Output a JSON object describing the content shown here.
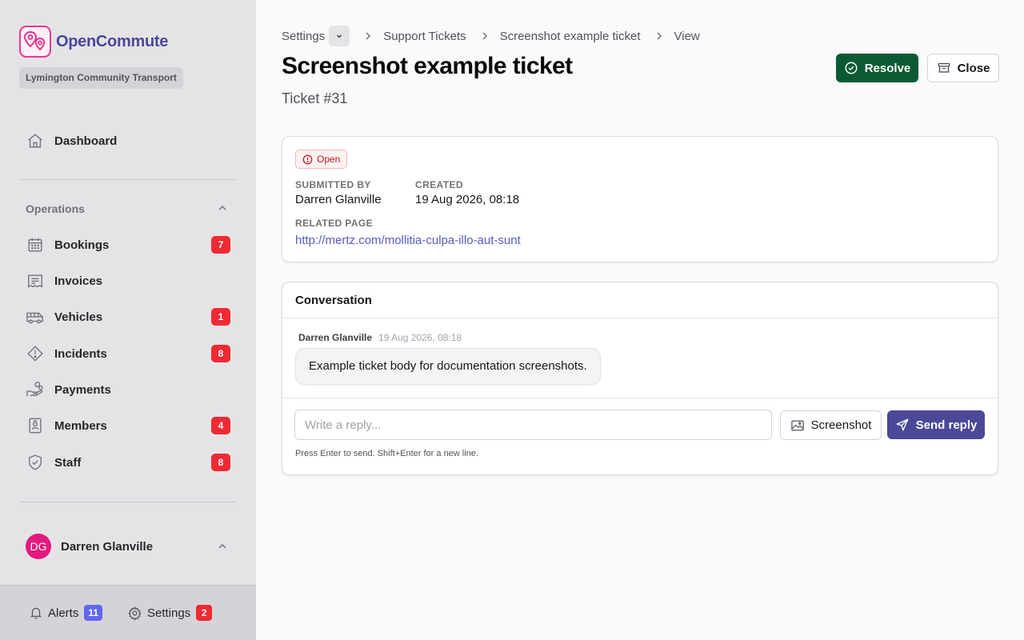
{
  "brand": {
    "name": "OpenCommute",
    "org": "Lymington Community Transport"
  },
  "sidebar": {
    "dashboard": {
      "label": "Dashboard",
      "icon": "home-icon"
    },
    "group": {
      "label": "Operations"
    },
    "items": [
      {
        "label": "Bookings",
        "icon": "calendar-icon",
        "badge": "7"
      },
      {
        "label": "Invoices",
        "icon": "receipt-icon",
        "badge": ""
      },
      {
        "label": "Vehicles",
        "icon": "bus-icon",
        "badge": "1"
      },
      {
        "label": "Incidents",
        "icon": "warning-diamond-icon",
        "badge": "8"
      },
      {
        "label": "Payments",
        "icon": "hand-coins-icon",
        "badge": ""
      },
      {
        "label": "Members",
        "icon": "id-card-icon",
        "badge": "4"
      },
      {
        "label": "Staff",
        "icon": "shield-check-icon",
        "badge": "8"
      }
    ],
    "user": {
      "initials": "DG",
      "name": "Darren Glanville"
    },
    "footer": {
      "alerts": {
        "label": "Alerts",
        "badge": "11"
      },
      "settings": {
        "label": "Settings",
        "badge": "2"
      }
    }
  },
  "breadcrumb": [
    "Settings",
    "Support Tickets",
    "Screenshot example ticket",
    "View"
  ],
  "header": {
    "title": "Screenshot example ticket",
    "subtitle": "Ticket #31",
    "resolve_label": "Resolve",
    "close_label": "Close"
  },
  "ticket": {
    "status": "Open",
    "submitted_by_label": "SUBMITTED BY",
    "submitted_by": "Darren Glanville",
    "created_label": "CREATED",
    "created": "19 Aug 2026, 08:18",
    "related_page_label": "RELATED PAGE",
    "related_page": "http://mertz.com/mollitia-culpa-illo-aut-sunt"
  },
  "conversation": {
    "title": "Conversation",
    "messages": [
      {
        "author": "Darren Glanville",
        "time": "19 Aug 2026, 08:18",
        "body": "Example ticket body for documentation screenshots."
      }
    ],
    "reply_placeholder": "Write a reply...",
    "screenshot_label": "Screenshot",
    "send_label": "Send reply",
    "hint": "Press Enter to send. Shift+Enter for a new line."
  },
  "colors": {
    "brand": "#4b4897",
    "logo": "#e8358f",
    "resolve": "#0b5a34",
    "badge": "#ef2a33",
    "alerts_badge": "#6366f1",
    "avatar": "#e3197d"
  }
}
